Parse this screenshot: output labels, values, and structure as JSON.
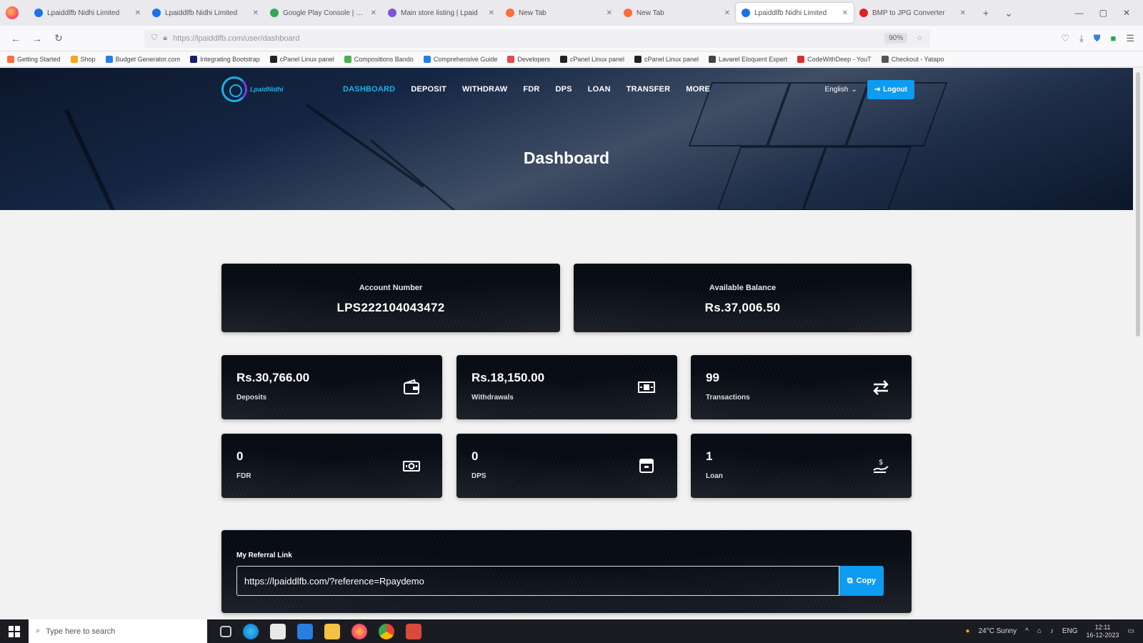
{
  "browser": {
    "tabs": [
      {
        "title": "Lpaiddlfb Nidhi Limited",
        "color": "#1a73e8"
      },
      {
        "title": "Lpaiddlfb Nidhi Limited",
        "color": "#1a73e8"
      },
      {
        "title": "Google Play Console | Goo",
        "color": "#34a853"
      },
      {
        "title": "Main store listing | Lpaid",
        "color": "#7b57d6"
      },
      {
        "title": "New Tab",
        "color": "#ff6b3d"
      },
      {
        "title": "New Tab",
        "color": "#ff6b3d"
      },
      {
        "title": "Lpaiddlfb Nidhi Limited",
        "color": "#1a73e8",
        "active": true
      },
      {
        "title": "BMP to JPG Converter",
        "color": "#e02020"
      }
    ],
    "url": "https://lpaiddlfb.com/user/dashboard",
    "zoom": "90%",
    "bookmarks": [
      "Getting Started",
      "Shop",
      "Budget Generator.com",
      "Integrating Bootstrap",
      "cPanel Linux panel",
      "Compositions Bando",
      "Comprehensive Guide",
      "Developers",
      "cPanel Linux panel",
      "cPanel Linux panel",
      "Lavarel Eloquent Expert",
      "CodeWithDeep - YouT",
      "Checkout - Yatapo"
    ]
  },
  "site": {
    "brand": "LpaidNidhi",
    "menu": [
      "DASHBOARD",
      "DEPOSIT",
      "WITHDRAW",
      "FDR",
      "DPS",
      "LOAN",
      "TRANSFER",
      "MORE"
    ],
    "language": "English",
    "logout_label": "Logout",
    "page_title": "Dashboard"
  },
  "account": {
    "number_label": "Account Number",
    "number": "LPS222104043472",
    "balance_label": "Available Balance",
    "balance": "Rs.37,006.50"
  },
  "stats": [
    {
      "value": "Rs.30,766.00",
      "label": "Deposits",
      "icon": "wallet-icon"
    },
    {
      "value": "Rs.18,150.00",
      "label": "Withdrawals",
      "icon": "cash-icon"
    },
    {
      "value": "99",
      "label": "Transactions",
      "icon": "exchange-icon"
    },
    {
      "value": "0",
      "label": "FDR",
      "icon": "money-bill-icon"
    },
    {
      "value": "0",
      "label": "DPS",
      "icon": "archive-icon"
    },
    {
      "value": "1",
      "label": "Loan",
      "icon": "hand-dollar-icon"
    }
  ],
  "referral": {
    "label": "My Referral Link",
    "link": "https://lpaiddlfb.com/?reference=Rpaydemo",
    "copy_label": "Copy"
  },
  "taskbar": {
    "search_placeholder": "Type here to search",
    "weather": "24°C Sunny",
    "lang": "ENG",
    "time": "12:11",
    "date": "16-12-2023"
  }
}
